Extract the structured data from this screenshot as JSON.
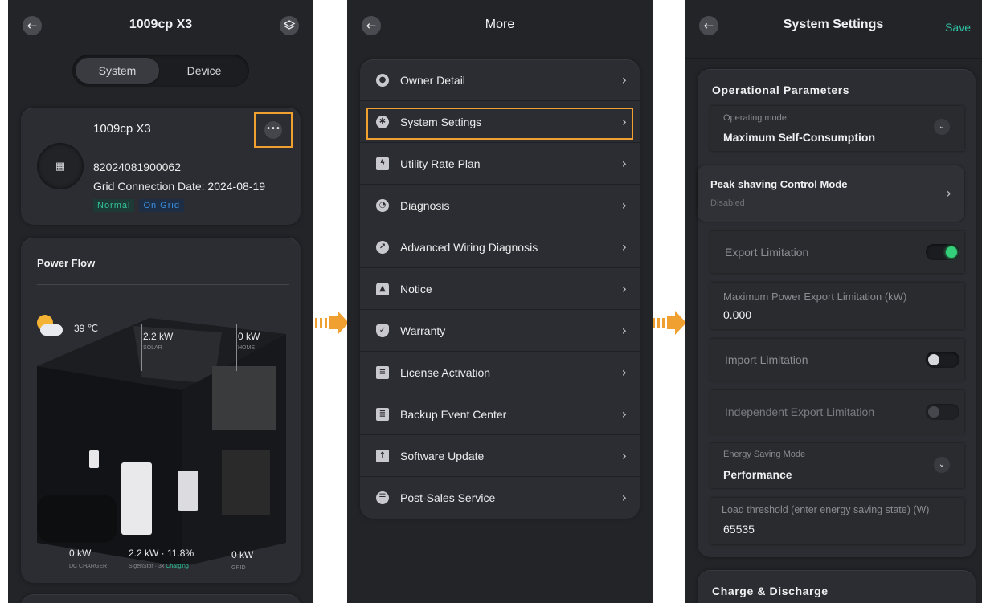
{
  "panel1": {
    "title": "1009cp X3",
    "tabs": [
      "System",
      "Device"
    ],
    "system": {
      "name": "1009cp X3",
      "serial": "82024081900062",
      "grid_date": "Grid Connection Date: 2024-08-19",
      "status": "Normal",
      "grid_status": "On Grid"
    },
    "power_flow": {
      "title": "Power Flow",
      "temperature": "39 ℃",
      "solar_value": "2.2 kW",
      "solar_label": "SOLAR",
      "home_value": "0 kW",
      "home_label": "HOME",
      "dc_value": "0 kW",
      "dc_label": "DC CHARGER",
      "batt_value": "2.2 kW · 11.8%",
      "batt_label": "SigenStor · 3x",
      "batt_state": "Charging",
      "grid_value": "0 kW",
      "grid_label": "GRID"
    }
  },
  "panel2": {
    "title": "More",
    "items": [
      {
        "label": "Owner Detail",
        "icon": "user-icon"
      },
      {
        "label": "System Settings",
        "icon": "gear-icon"
      },
      {
        "label": "Utility Rate Plan",
        "icon": "bookmark-bolt-icon"
      },
      {
        "label": "Diagnosis",
        "icon": "diagnosis-icon"
      },
      {
        "label": "Advanced Wiring Diagnosis",
        "icon": "compass-icon"
      },
      {
        "label": "Notice",
        "icon": "alarm-icon"
      },
      {
        "label": "Warranty",
        "icon": "shield-check-icon"
      },
      {
        "label": "License Activation",
        "icon": "certificate-icon"
      },
      {
        "label": "Backup Event Center",
        "icon": "clipboard-icon"
      },
      {
        "label": "Software Update",
        "icon": "upload-icon"
      },
      {
        "label": "Post-Sales Service",
        "icon": "service-icon"
      }
    ]
  },
  "panel3": {
    "title": "System Settings",
    "save": "Save",
    "section": "Operational Parameters",
    "operating_mode_label": "Operating mode",
    "operating_mode_value": "Maximum Self-Consumption",
    "peak_title": "Peak shaving Control Mode",
    "peak_value": "Disabled",
    "export_limit": "Export Limitation",
    "max_export_label": "Maximum Power Export Limitation (kW)",
    "max_export_value": "0.000",
    "import_limit": "Import Limitation",
    "independent_export": "Independent Export Limitation",
    "energy_mode_label": "Energy Saving Mode",
    "energy_mode_value": "Performance",
    "load_threshold_label": "Load threshold (enter energy saving state) (W)",
    "load_threshold_value": "65535",
    "charge_section": "Charge & Discharge"
  },
  "toggles": {
    "export_limitation": true,
    "import_limitation": false,
    "independent_export_limitation": false
  },
  "colors": {
    "background": "#232428",
    "card": "#2c2d32",
    "highlight": "#f0a030",
    "accent_green": "#35d07a",
    "save_text": "#2fc1a3"
  }
}
